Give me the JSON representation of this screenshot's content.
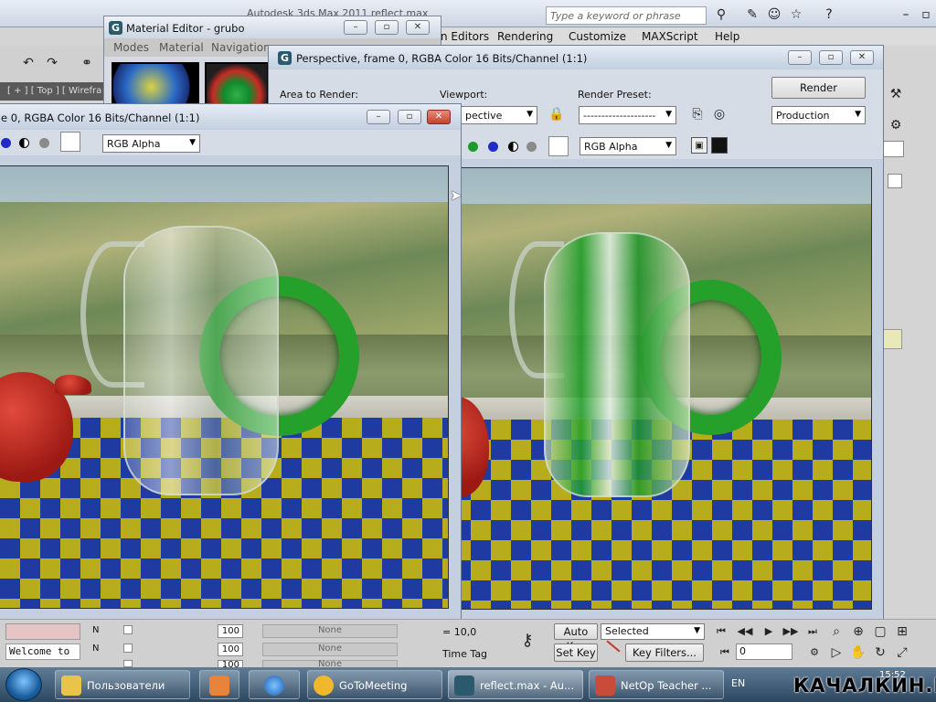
{
  "main_window": {
    "title": "Autodesk 3ds Max 2011     reflect.max",
    "search_placeholder": "Type a keyword or phrase",
    "menu": [
      "n Editors",
      "Rendering",
      "Customize",
      "MAXScript",
      "Help"
    ],
    "viewport_label": "[ + ] [ Top ] [ Wirefra"
  },
  "material_editor": {
    "title": "Material Editor - grubo",
    "menu": [
      "Modes",
      "Material",
      "Navigation"
    ]
  },
  "render_frame_left": {
    "title": "e 0, RGBA Color 16 Bits/Channel (1:1)",
    "channel_select": "RGB Alpha"
  },
  "render_frame_right": {
    "title": "Perspective, frame 0, RGBA Color 16 Bits/Channel (1:1)",
    "area_to_render_label": "Area to Render:",
    "viewport_label": "Viewport:",
    "viewport_value": "pective",
    "render_preset_label": "Render Preset:",
    "render_preset_value": "--------------------",
    "render_button": "Render",
    "production_select": "Production",
    "channel_select": "RGB Alpha"
  },
  "bottom": {
    "welcome_text": "Welcome to",
    "spinner_values": [
      "100",
      "100",
      "100"
    ],
    "none_labels": [
      "None",
      "None",
      "None"
    ],
    "coord_value": "= 10,0",
    "time_tag": "Time Tag",
    "auto_key": "Auto Key",
    "set_key": "Set Key",
    "selected_select": "Selected",
    "key_filters": "Key Filters...",
    "frame_value": "0",
    "clock": "15:52"
  },
  "taskbar": {
    "items": [
      "Пользователи",
      "GoToMeeting",
      "reflect.max - Au...",
      "NetOp Teacher ..."
    ],
    "language": "EN"
  },
  "watermark": "КАЧАЛКИН.РУ"
}
